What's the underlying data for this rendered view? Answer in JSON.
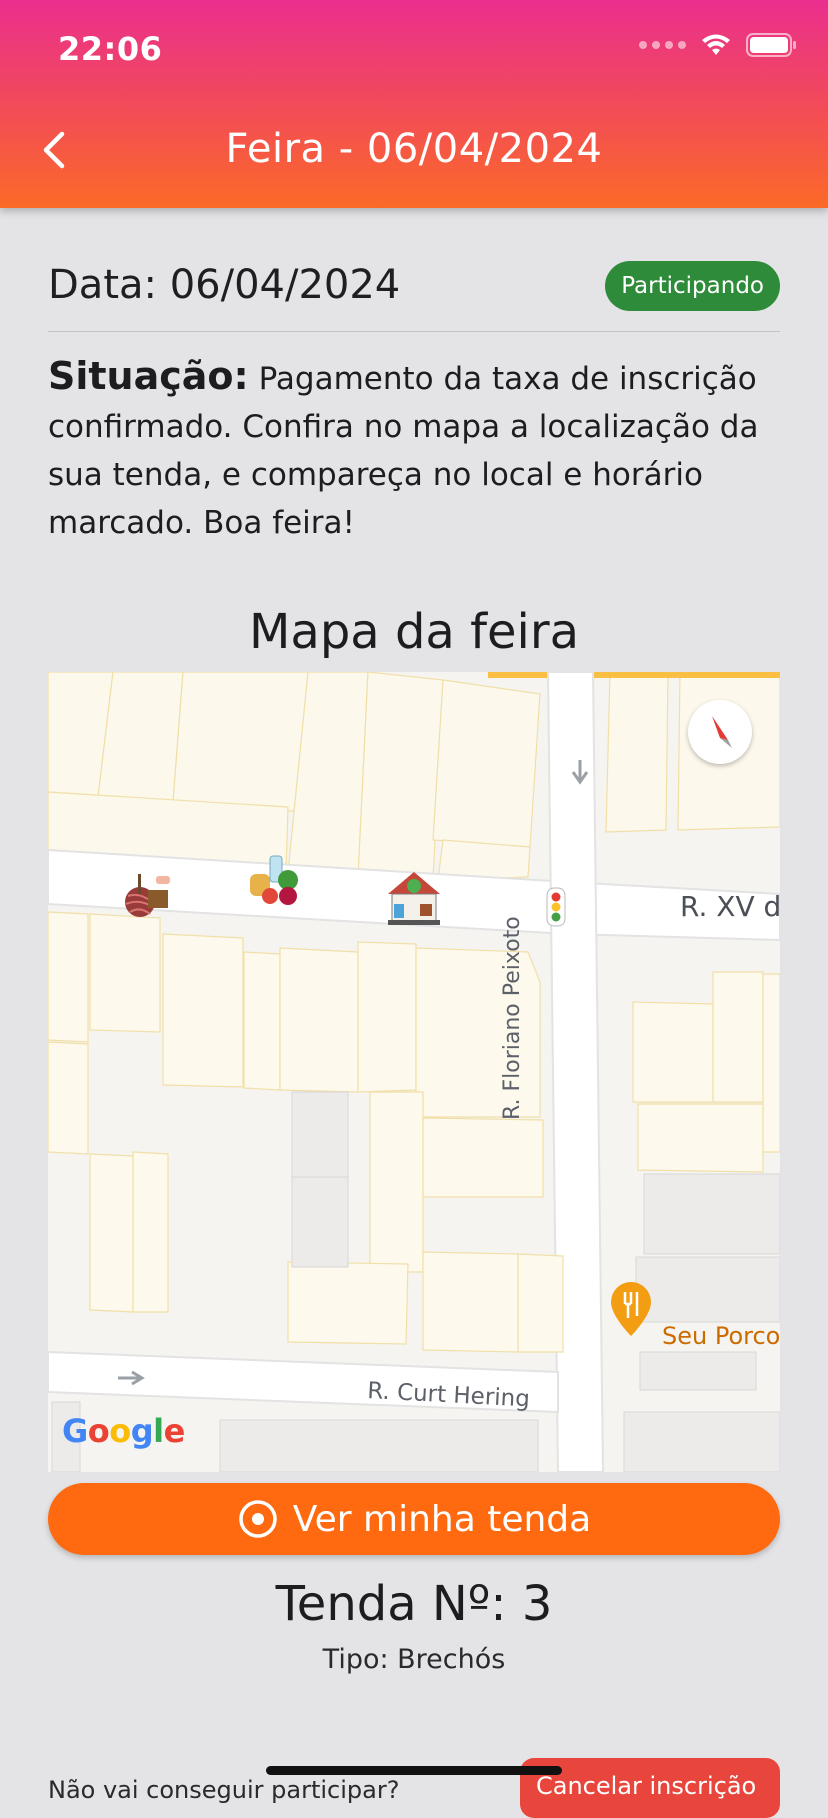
{
  "status_bar": {
    "time": "22:06"
  },
  "header": {
    "title": "Feira - 06/04/2024"
  },
  "fair": {
    "date_label": "Data: 06/04/2024",
    "status_badge": "Participando",
    "status_badge_color": "#2e8b3a",
    "situation_label": "Situação:",
    "situation_text": "Pagamento da taxa de inscrição confirmado. Confira no mapa a localização da sua tenda, e compareça no local e horário marcado. Boa feira!"
  },
  "map": {
    "title": "Mapa da feira",
    "streets": {
      "xv": "R. XV d",
      "curt": "R. Curt Hering",
      "floriano": "R. Floriano Peixoto"
    },
    "poi": "Seu Porco",
    "google_letters": [
      "G",
      "o",
      "o",
      "g",
      "l",
      "e"
    ],
    "google_colors": [
      "#4285f4",
      "#ea4335",
      "#fbbc05",
      "#4285f4",
      "#34a853",
      "#ea4335"
    ],
    "markers": [
      "crafts-stall-icon",
      "food-stall-icon",
      "thrift-store-icon",
      "traffic-light-icon"
    ]
  },
  "actions": {
    "view_tent": "Ver minha tenda",
    "cant_participate": "Não vai conseguir participar?",
    "cancel": "Cancelar inscrição"
  },
  "tent": {
    "number_label": "Tenda Nº: 3",
    "type_label": "Tipo: Brechós"
  },
  "colors": {
    "accent": "#ff6a10",
    "header_top": "#ea2f8e",
    "danger": "#e8453c"
  }
}
